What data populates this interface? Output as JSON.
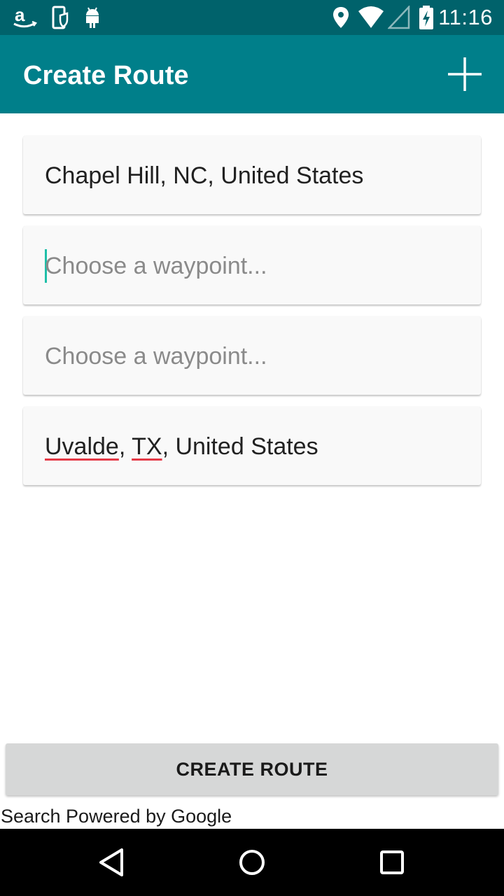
{
  "status_bar": {
    "time": "11:16",
    "icons_left": [
      "amazon-icon",
      "device-shield-icon",
      "android-icon"
    ],
    "icons_right": [
      "location-icon",
      "wifi-icon",
      "signal-icon",
      "battery-charging-icon"
    ]
  },
  "app_bar": {
    "title": "Create Route",
    "add_icon": "plus-icon"
  },
  "route": {
    "origin": {
      "value": "Chapel Hill, NC, United States"
    },
    "waypoint_1": {
      "placeholder": "Choose a waypoint...",
      "value": "",
      "focused": true
    },
    "waypoint_2": {
      "placeholder": "Choose a waypoint...",
      "value": ""
    },
    "destination": {
      "part1": "Uvalde",
      "sep1": ", ",
      "part2": "TX",
      "rest": ", United States"
    }
  },
  "actions": {
    "create_label": "CREATE ROUTE"
  },
  "footer": {
    "powered_by": "Search Powered by Google"
  },
  "nav_bar": {
    "back_icon": "back-triangle-icon",
    "home_icon": "home-circle-icon",
    "recents_icon": "recents-square-icon"
  },
  "colors": {
    "status_bar": "#00626b",
    "app_bar": "#007f8a",
    "cursor": "#1fbfa8",
    "spellcheck": "#e53946"
  }
}
